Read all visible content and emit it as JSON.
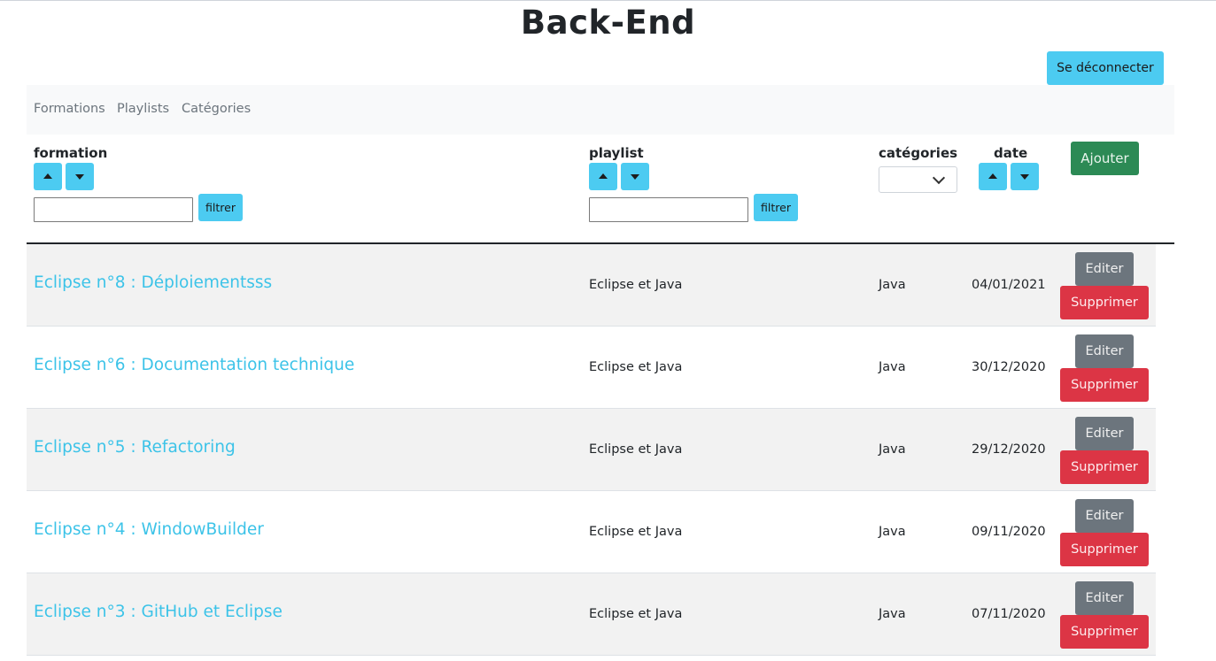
{
  "page": {
    "title": "Back-End"
  },
  "header": {
    "logout_label": "Se déconnecter"
  },
  "nav": {
    "items": [
      "Formations",
      "Playlists",
      "Catégories"
    ]
  },
  "columns": {
    "formation": "formation",
    "playlist": "playlist",
    "categories": "catégories",
    "date": "date",
    "filter_label": "filtrer",
    "category_selected": "",
    "add_label": "Ajouter"
  },
  "actions": {
    "edit_label": "Editer",
    "delete_label": "Supprimer"
  },
  "rows": [
    {
      "title": "Eclipse n°8 : Déploiementsss",
      "playlist": "Eclipse et Java",
      "category": "Java",
      "date": "04/01/2021"
    },
    {
      "title": "Eclipse n°6 : Documentation technique",
      "playlist": "Eclipse et Java",
      "category": "Java",
      "date": "30/12/2020"
    },
    {
      "title": "Eclipse n°5 : Refactoring",
      "playlist": "Eclipse et Java",
      "category": "Java",
      "date": "29/12/2020"
    },
    {
      "title": "Eclipse n°4 : WindowBuilder",
      "playlist": "Eclipse et Java",
      "category": "Java",
      "date": "09/11/2020"
    },
    {
      "title": "Eclipse n°3 : GitHub et Eclipse",
      "playlist": "Eclipse et Java",
      "category": "Java",
      "date": "07/11/2020"
    }
  ],
  "colors": {
    "info": "#4ccbf1",
    "success": "#2c8a55",
    "secondary": "#6c757d",
    "danger": "#dc3545",
    "link": "#3cc3e8"
  }
}
